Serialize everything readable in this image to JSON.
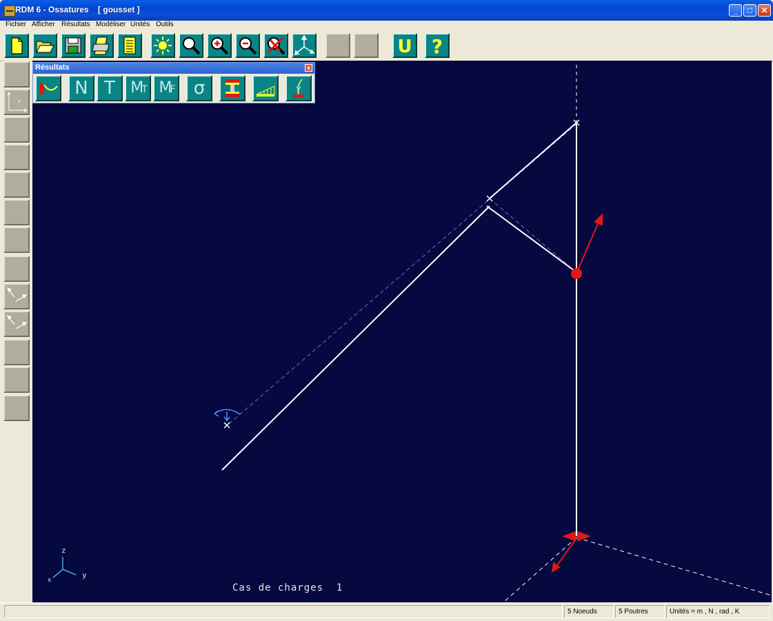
{
  "window": {
    "title": "RDM 6 - Ossatures    [ gousset ]",
    "controls": [
      "minimize",
      "maximize",
      "close"
    ]
  },
  "menu": {
    "items": [
      "Fichier",
      "Afficher",
      "Résultats",
      "Modéliser",
      "Unités",
      "Outils"
    ]
  },
  "toolbar": {
    "buttons": [
      "new-document-icon",
      "open-folder-icon",
      "save-disk-icon",
      "print-icon",
      "notepad-icon",
      "sun-icon",
      "magnify-icon",
      "zoom-in-icon",
      "zoom-out-icon",
      "zoom-cancel-icon",
      "axes-3d-icon",
      "blank",
      "blank",
      "u-icon",
      "help-icon"
    ],
    "u_label": "U",
    "help_label": "?"
  },
  "results_palette": {
    "title": "Résultats",
    "close_label": "x",
    "buttons": [
      {
        "name": "deformed-shape",
        "label": ""
      },
      {
        "name": "normal-force",
        "label": "N"
      },
      {
        "name": "shear-force",
        "label": "T"
      },
      {
        "name": "torsion-moment",
        "label": "M",
        "sub": "T"
      },
      {
        "name": "bending-moment",
        "label": "M",
        "sub": "F"
      },
      {
        "name": "stress",
        "label": "σ"
      },
      {
        "name": "section-stress",
        "label": ""
      },
      {
        "name": "load-bars",
        "label": ""
      },
      {
        "name": "reaction",
        "label": ""
      }
    ]
  },
  "left_toolbar": {
    "buttons": [
      "blank",
      "axis-frame-icon",
      "blank",
      "blank",
      "blank",
      "blank",
      "blank",
      "blank",
      "arrows-icon",
      "arrows-icon",
      "blank",
      "blank",
      "blank"
    ]
  },
  "canvas": {
    "background": "#05093f",
    "load_case": "Cas de charges  1",
    "axis_labels": {
      "z": "z",
      "y": "y",
      "x": "x"
    },
    "colors": {
      "beam": "#ffffff",
      "deformed": "#b04cc8",
      "load": "#e01818",
      "support": "#4f8fff"
    }
  },
  "status": {
    "nodes": "5 Noeuds",
    "beams": "5 Poutres",
    "units": "Unités = m , N , rad , K"
  }
}
